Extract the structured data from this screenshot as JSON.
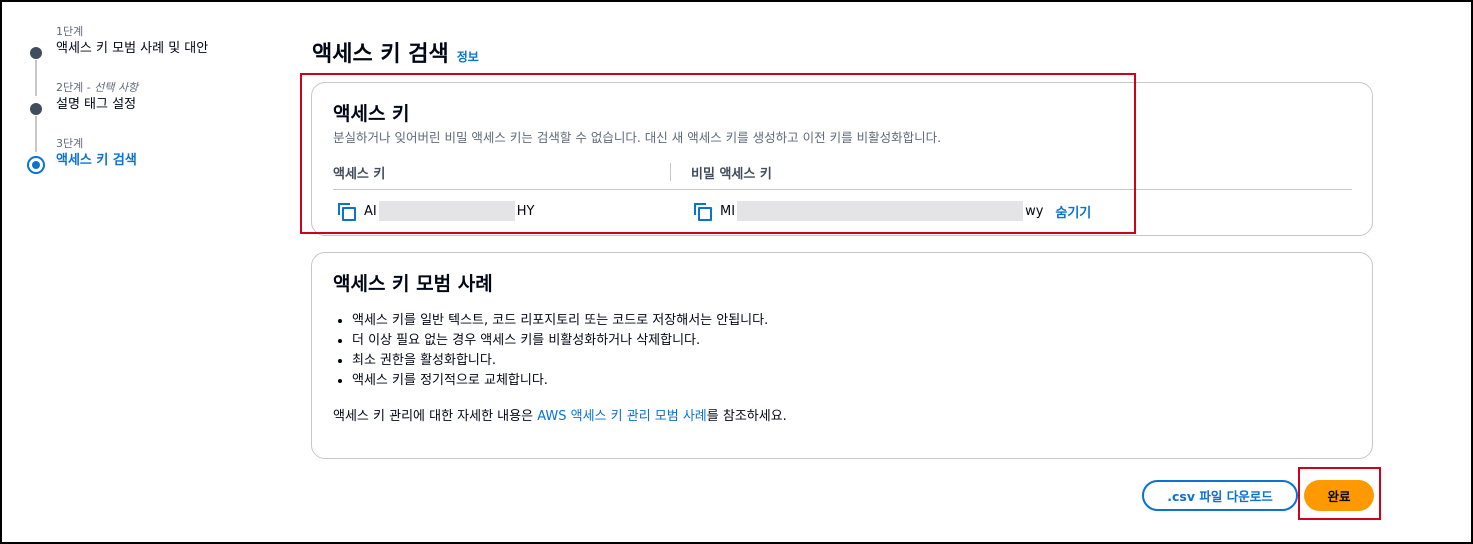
{
  "stepper": [
    {
      "label": "1단계",
      "optional": "",
      "title": "액세스 키 모범 사례 및 대안"
    },
    {
      "label": "2단계 - ",
      "optional": "선택 사항",
      "title": "설명 태그 설정"
    },
    {
      "label": "3단계",
      "optional": "",
      "title": "액세스 키 검색"
    }
  ],
  "page": {
    "title": "액세스 키 검색",
    "info_link": "정보"
  },
  "access_key_card": {
    "title": "액세스 키",
    "description": "분실하거나 잊어버린 비밀 액세스 키는 검색할 수 없습니다. 대신 새 액세스 키를 생성하고 이전 키를 비활성화합니다.",
    "col_access_key": "액세스 키",
    "col_secret_key": "비밀 액세스 키",
    "access_key_prefix": "AI",
    "access_key_suffix": "HY",
    "secret_key_prefix": "MI",
    "secret_key_suffix": "wy",
    "hide_link": "숨기기"
  },
  "best_practices_card": {
    "title": "액세스 키 모범 사례",
    "items": [
      "액세스 키를 일반 텍스트, 코드 리포지토리 또는 코드로 저장해서는 안됩니다.",
      "더 이상 필요 없는 경우 액세스 키를 비활성화하거나 삭제합니다.",
      "최소 권한을 활성화합니다.",
      "액세스 키를 정기적으로 교체합니다."
    ],
    "footnote_before": "액세스 키 관리에 대한 자세한 내용은 ",
    "footnote_link": "AWS 액세스 키 관리 모범 사례",
    "footnote_after": "를 참조하세요."
  },
  "actions": {
    "download_csv": ".csv 파일 다운로드",
    "done": "완료"
  },
  "colors": {
    "accent": "#0972d3",
    "primary_button": "#ff9900",
    "highlight": "#d0021b"
  }
}
